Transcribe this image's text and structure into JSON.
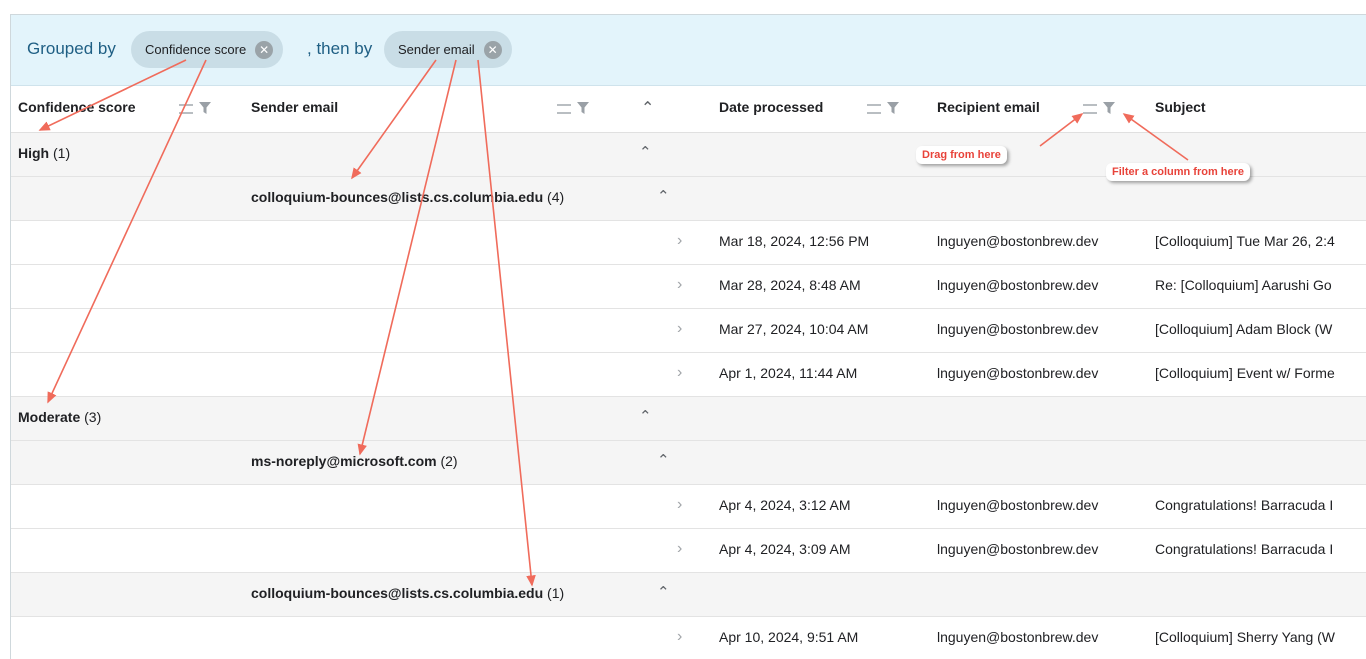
{
  "group_bar": {
    "label_prefix": "Grouped by",
    "chips": [
      {
        "label": "Confidence score"
      },
      {
        "label": "Sender email"
      }
    ],
    "label_then": ", then by"
  },
  "columns": {
    "confidence": "Confidence score",
    "sender": "Sender email",
    "date": "Date processed",
    "recipient": "Recipient email",
    "subject": "Subject"
  },
  "rows": [
    {
      "type": "group1",
      "label": "High",
      "count": "(1)"
    },
    {
      "type": "group2",
      "label": "colloquium-bounces@lists.cs.columbia.edu",
      "count": "(4)"
    },
    {
      "type": "data",
      "date": "Mar 18, 2024, 12:56 PM",
      "recipient": "lnguyen@bostonbrew.dev",
      "subject": "[Colloquium] Tue Mar 26, 2:4"
    },
    {
      "type": "data",
      "date": "Mar 28, 2024, 8:48 AM",
      "recipient": "lnguyen@bostonbrew.dev",
      "subject": "Re: [Colloquium] Aarushi Go"
    },
    {
      "type": "data",
      "date": "Mar 27, 2024, 10:04 AM",
      "recipient": "lnguyen@bostonbrew.dev",
      "subject": "[Colloquium] Adam Block (W"
    },
    {
      "type": "data",
      "date": "Apr 1, 2024, 11:44 AM",
      "recipient": "lnguyen@bostonbrew.dev",
      "subject": "[Colloquium] Event w/ Forme"
    },
    {
      "type": "group1",
      "label": "Moderate",
      "count": "(3)"
    },
    {
      "type": "group2",
      "label": "ms-noreply@microsoft.com",
      "count": "(2)"
    },
    {
      "type": "data",
      "date": "Apr 4, 2024, 3:12 AM",
      "recipient": "lnguyen@bostonbrew.dev",
      "subject": "Congratulations! Barracuda I"
    },
    {
      "type": "data",
      "date": "Apr 4, 2024, 3:09 AM",
      "recipient": "lnguyen@bostonbrew.dev",
      "subject": "Congratulations! Barracuda I"
    },
    {
      "type": "group2",
      "label": "colloquium-bounces@lists.cs.columbia.edu",
      "count": "(1)"
    },
    {
      "type": "data",
      "date": "Apr 10, 2024, 9:51 AM",
      "recipient": "lnguyen@bostonbrew.dev",
      "subject": "[Colloquium] Sherry Yang (W"
    }
  ],
  "annotations": {
    "drag": "Drag from here",
    "filter": "Filter a column from here"
  },
  "colors": {
    "group_bar_bg": "#e3f4fb",
    "chip_bg": "#c9dde6",
    "group_row_bg": "#f5f5f5",
    "annotation_red": "#e8433a"
  },
  "icons": [
    "close-circle-icon",
    "drag-handle-icon",
    "filter-funnel-icon",
    "collapse-all-icon",
    "caret-up-icon",
    "chevron-right-icon"
  ]
}
